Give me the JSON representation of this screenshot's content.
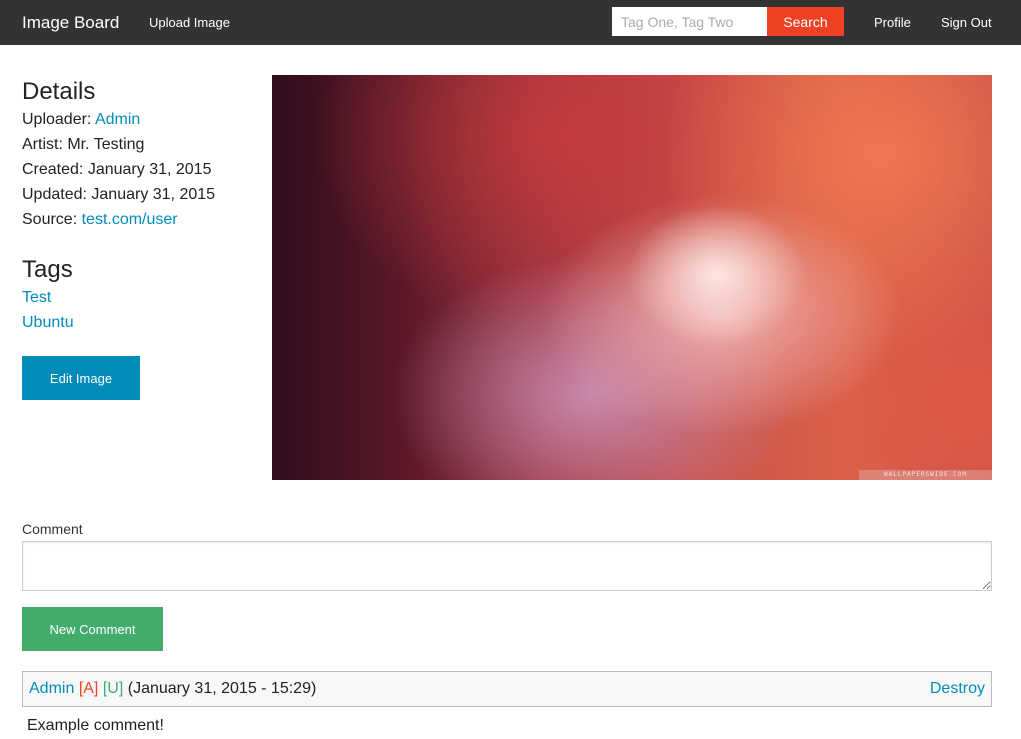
{
  "nav": {
    "brand": "Image Board",
    "upload_label": "Upload Image",
    "search_placeholder": "Tag One, Tag Two",
    "search_label": "Search",
    "profile_label": "Profile",
    "signout_label": "Sign Out"
  },
  "details": {
    "heading": "Details",
    "uploader_label": "Uploader:",
    "uploader": "Admin",
    "artist_label": "Artist:",
    "artist": "Mr. Testing",
    "created_label": "Created:",
    "created": "January 31, 2015",
    "updated_label": "Updated:",
    "updated": "January 31, 2015",
    "source_label": "Source:",
    "source": "test.com/user"
  },
  "tags": {
    "heading": "Tags",
    "items": [
      "Test",
      "Ubuntu"
    ]
  },
  "edit_label": "Edit Image",
  "image": {
    "watermark": "WALLPAPERSWIDE.COM"
  },
  "comment_form": {
    "label": "Comment",
    "value": "",
    "submit_label": "New Comment"
  },
  "comments": [
    {
      "author": "Admin",
      "badge_a": "[A]",
      "badge_u": "[U]",
      "timestamp": "(January 31, 2015 - 15:29)",
      "destroy_label": "Destroy",
      "body": "Example comment!"
    }
  ],
  "colors": {
    "topbar": "#333333",
    "link": "#008cba",
    "search_button": "#f04124",
    "new_comment_button": "#43ac6a",
    "badge_admin": "#f04124",
    "badge_user": "#43ac6a"
  }
}
